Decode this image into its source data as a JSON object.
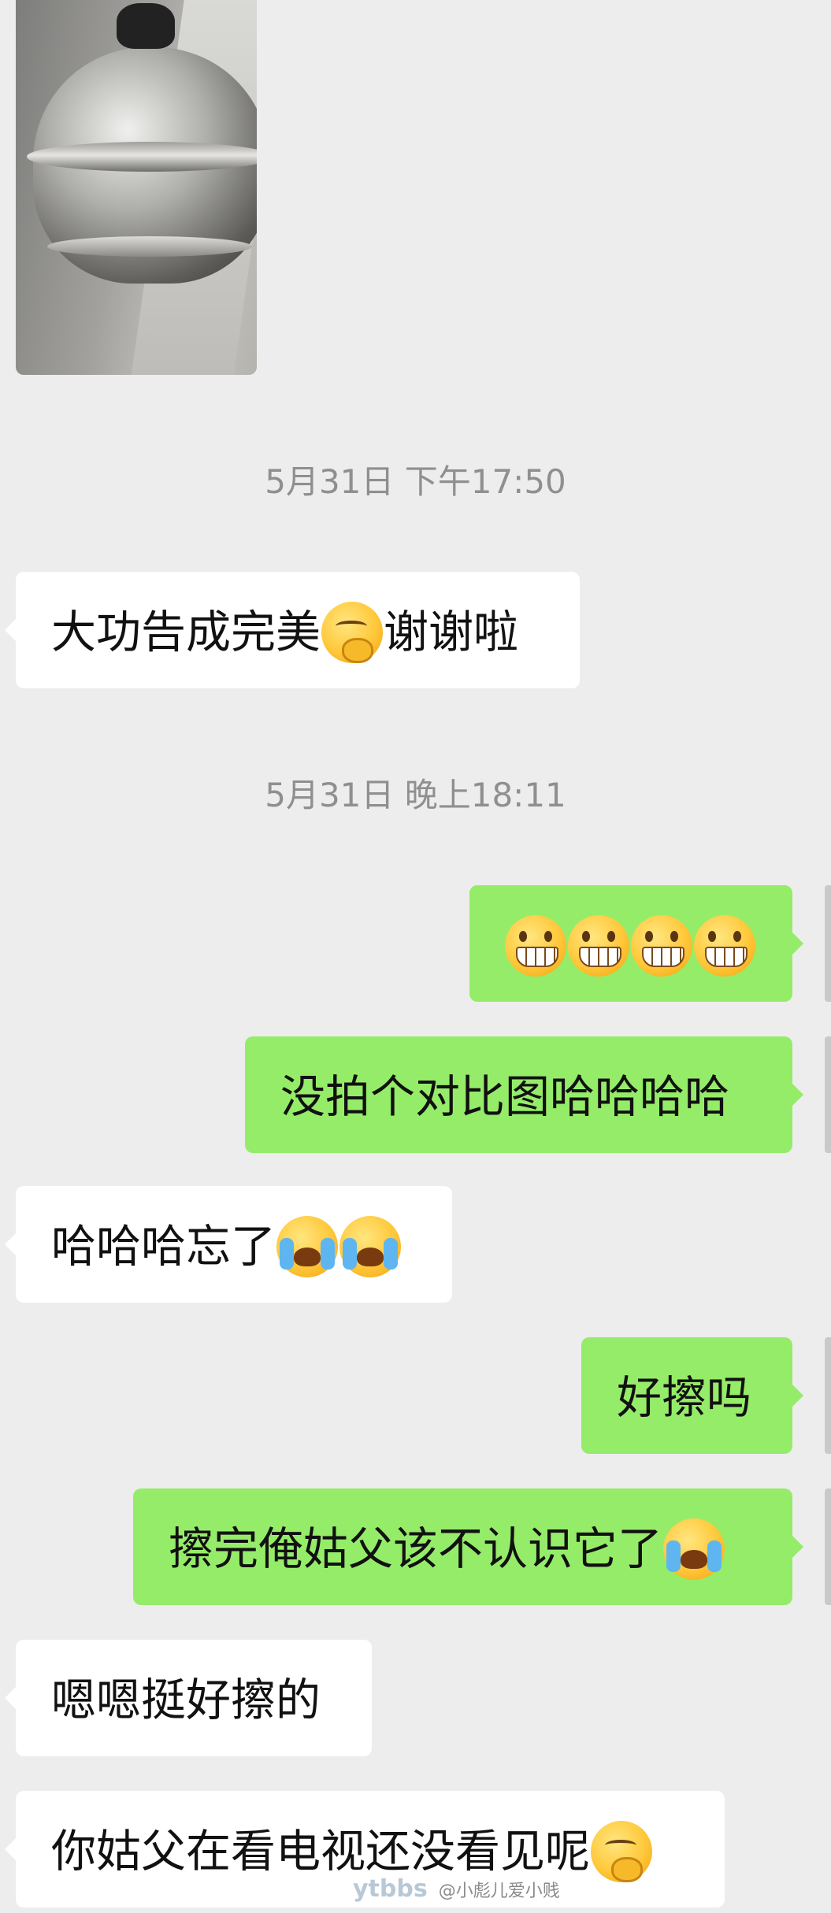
{
  "messages": [
    {
      "type": "image",
      "side": "left",
      "content": "steamer pot photo"
    },
    {
      "type": "timestamp",
      "text": "5月31日 下午17:50"
    },
    {
      "type": "text",
      "side": "left",
      "text": "大功告成完美",
      "emoji_after": "think-emoji",
      "text2": "谢谢啦"
    },
    {
      "type": "timestamp",
      "text": "5月31日 晚上18:11"
    },
    {
      "type": "emoji",
      "side": "right",
      "emojis": [
        "grin-emoji",
        "grin-emoji",
        "grin-emoji",
        "grin-emoji"
      ]
    },
    {
      "type": "text",
      "side": "right",
      "text": "没拍个对比图哈哈哈哈"
    },
    {
      "type": "text",
      "side": "left",
      "text": "哈哈哈忘了",
      "emoji_after": [
        "cry-laugh-emoji",
        "cry-laugh-emoji"
      ]
    },
    {
      "type": "text",
      "side": "right",
      "text": "好擦吗"
    },
    {
      "type": "text",
      "side": "right",
      "text": "擦完俺姑父该不认识它了",
      "emoji_after": "cry-laugh-emoji"
    },
    {
      "type": "text",
      "side": "left",
      "text": "嗯嗯挺好擦的"
    },
    {
      "type": "text",
      "side": "left",
      "text": "你姑父在看电视还没看见呢",
      "emoji_after": "think-emoji"
    }
  ],
  "watermark": {
    "logo": "ytbbs",
    "handle": "@小彪儿爱小贱"
  },
  "colors": {
    "background": "#ededed",
    "bubble_left": "#ffffff",
    "bubble_right": "#95ec69",
    "timestamp": "#8f8f8f"
  }
}
